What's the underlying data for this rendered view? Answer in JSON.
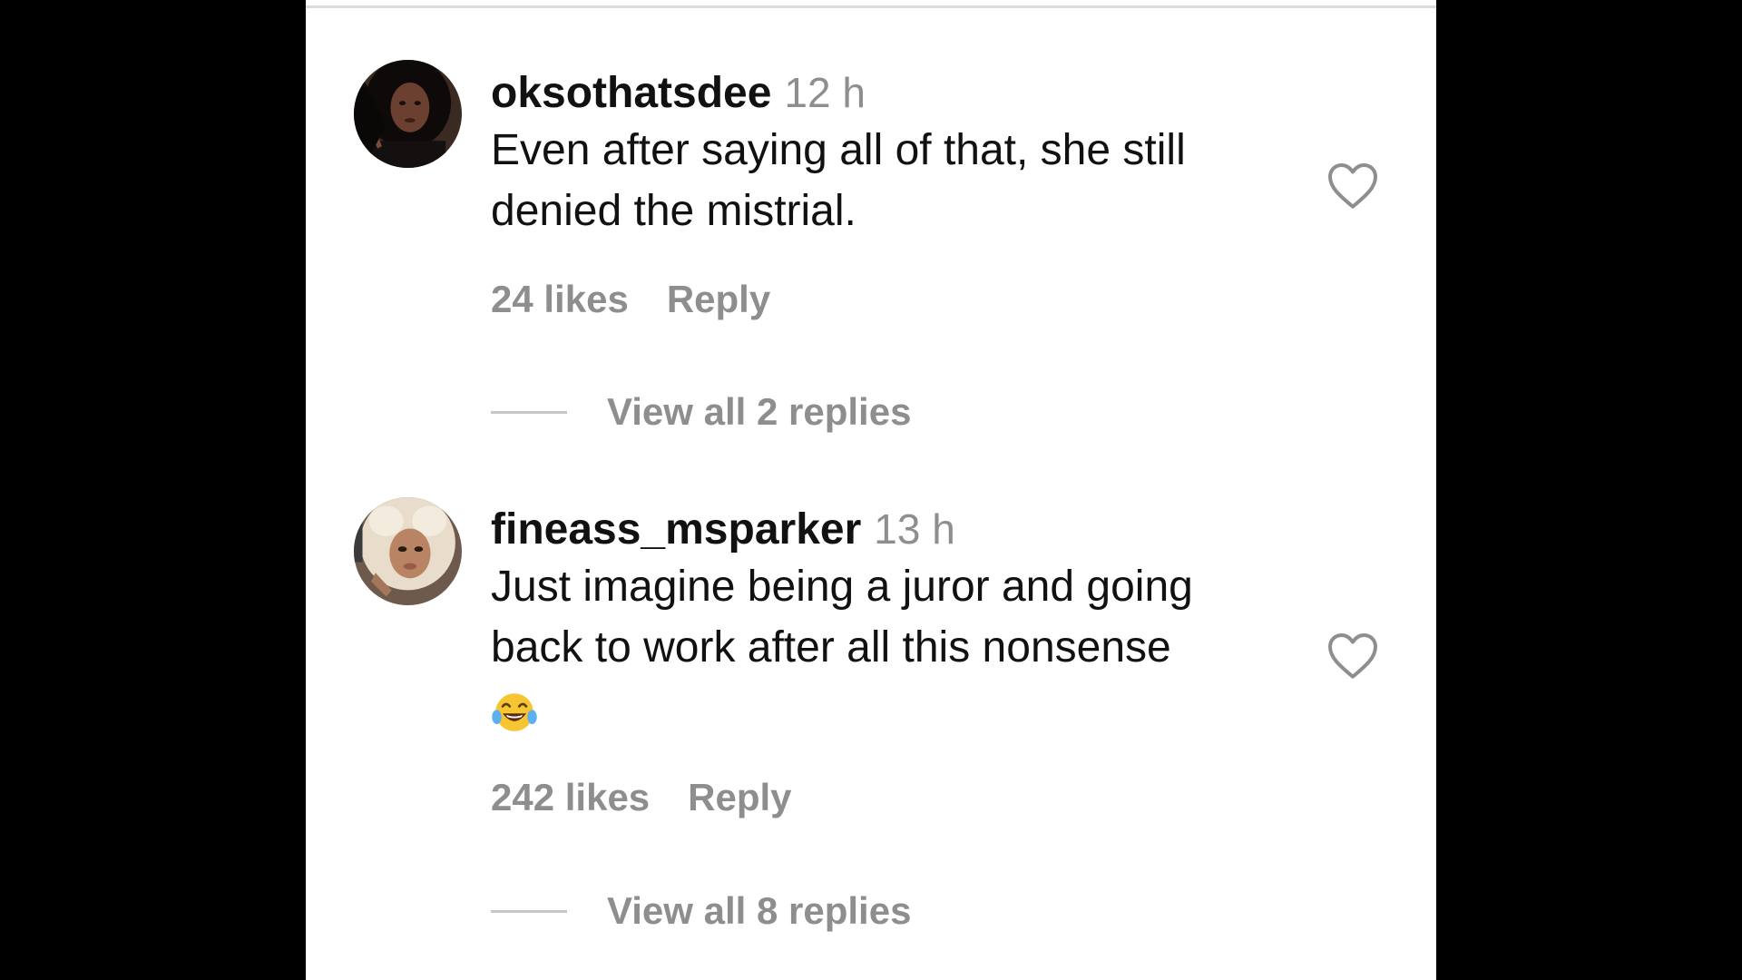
{
  "comments": [
    {
      "username": "oksothatsdee",
      "timestamp": "12 h",
      "text": "Even after saying all of that, she still denied the mistrial.",
      "likes": "24 likes",
      "reply_label": "Reply",
      "view_replies": "View all 2 replies",
      "avatar": "avatar-dark-hair",
      "like_icon": "heart-outline-icon"
    },
    {
      "username": "fineass_msparker",
      "timestamp": "13 h",
      "text": "Just imagine being a juror and going back to work after all this nonsense",
      "emoji": "tears-of-joy-emoji",
      "likes": "242 likes",
      "reply_label": "Reply",
      "view_replies": "View all 8 replies",
      "avatar": "avatar-blonde-hair",
      "like_icon": "heart-outline-icon"
    }
  ],
  "colors": {
    "background": "#000000",
    "panel": "#ffffff",
    "primary_text": "#111111",
    "secondary_text": "#8e8e8e"
  }
}
